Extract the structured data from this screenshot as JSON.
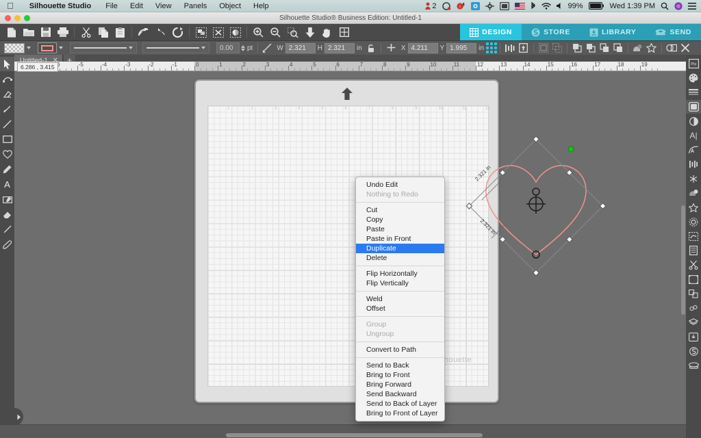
{
  "menubar": {
    "apple_icon": "apple-icon",
    "app_name": "Silhouette Studio",
    "items": [
      "File",
      "Edit",
      "View",
      "Panels",
      "Object",
      "Help"
    ],
    "status": {
      "user_count": "2",
      "battery_pct": "99%",
      "clock": "Wed 1:39 PM",
      "icons": [
        "user-icon",
        "dropbox-icon",
        "alert-icon",
        "photos-icon",
        "gear-icon",
        "display-icon",
        "flag-icon",
        "bluetooth-icon",
        "wifi-icon",
        "volume-icon",
        "battery-icon",
        "search-icon",
        "siri-icon",
        "notification-center-icon"
      ]
    }
  },
  "window": {
    "title": "Silhouette Studio® Business Edition: Untitled-1",
    "traffic_lights": [
      "close-button",
      "minimize-button",
      "zoom-button"
    ]
  },
  "toolbar_main": {
    "groups": [
      [
        "new-document-icon",
        "open-document-icon",
        "save-document-icon",
        "print-icon"
      ],
      [
        "cut-icon",
        "copy-icon",
        "paste-icon"
      ],
      [
        "undo-icon",
        "redo-icon",
        "refresh-icon"
      ],
      [
        "select-all-icon",
        "deselect-all-icon",
        "select-by-color-icon"
      ],
      [
        "zoom-in-icon",
        "zoom-out-icon",
        "zoom-selection-icon",
        "fit-to-page-icon",
        "pan-hand-icon",
        "fit-window-icon"
      ]
    ]
  },
  "mode_tabs": [
    {
      "label": "DESIGN",
      "icon": "grid-icon",
      "active": true
    },
    {
      "label": "STORE",
      "icon": "store-icon",
      "active": false
    },
    {
      "label": "LIBRARY",
      "icon": "library-icon",
      "active": false
    },
    {
      "label": "SEND",
      "icon": "send-icon",
      "active": false
    }
  ],
  "toolbar_props": {
    "fill_swatch": "transparent",
    "line_swatch_color": "#f0938c",
    "line_style_label": "solid-line",
    "line_weight_value": "0.00",
    "line_weight_unit": "pt",
    "width_label": "W",
    "width_value": "2.321",
    "height_label": "H",
    "height_value": "2.321",
    "size_unit": "in",
    "lock_aspect_icon": "unlocked-padlock-icon",
    "x_label": "X",
    "x_value": "4.211",
    "y_label": "Y",
    "y_value": "1.995",
    "position_unit": "in",
    "anchor_icon": "anchor-grid-icon",
    "right_icons": [
      "align-icon",
      "center-on-page-icon",
      "group-icon",
      "ungroup-icon",
      "bring-front-icon",
      "bring-forward-icon",
      "send-backward-icon",
      "send-back-icon",
      "shadow-icon",
      "effects-icon",
      "weld-icon",
      "close-icon"
    ]
  },
  "doc_tabs": {
    "tabs": [
      {
        "label": "Untitled-1",
        "close_icon": "close-tab-icon"
      }
    ],
    "new_tab_label": "+"
  },
  "rulers": {
    "cursor_coords": "6.286 , 3.415",
    "h_ticks": [
      "-6",
      "-5",
      "-4",
      "-3",
      "-2",
      "-1",
      "0",
      "1",
      "2",
      "3",
      "4",
      "5",
      "6",
      "7",
      "8",
      "9",
      "10",
      "11",
      "12",
      "13",
      "14",
      "15",
      "16",
      "17",
      "18",
      "19"
    ]
  },
  "left_tools": [
    {
      "icon": "select-arrow-icon",
      "selected": true
    },
    {
      "icon": "edit-points-icon",
      "selected": false
    },
    {
      "icon": "eraser-tool-icon",
      "selected": false
    },
    {
      "icon": "knife-tool-icon",
      "selected": false
    },
    {
      "icon": "line-tool-icon",
      "selected": false
    },
    {
      "icon": "rectangle-tool-icon",
      "selected": false
    },
    {
      "icon": "heart-shape-icon",
      "selected": false
    },
    {
      "icon": "pencil-tool-icon",
      "selected": false
    },
    {
      "icon": "text-tool-icon",
      "selected": false
    },
    {
      "icon": "note-tool-icon",
      "selected": false
    },
    {
      "icon": "eraser-icon",
      "selected": false
    },
    {
      "icon": "knife-icon",
      "selected": false
    },
    {
      "icon": "eyedropper-icon",
      "selected": false
    }
  ],
  "right_panels": [
    {
      "icon": "pixscan-icon",
      "selected": false
    },
    {
      "icon": "color-palette-icon",
      "selected": false
    },
    {
      "icon": "line-style-icon",
      "selected": false
    },
    {
      "icon": "fill-pattern-icon",
      "selected": true
    },
    {
      "icon": "contrast-icon",
      "selected": false
    },
    {
      "icon": "text-style-icon",
      "selected": false
    },
    {
      "icon": "curve-text-icon",
      "selected": false
    },
    {
      "icon": "align-panel-icon",
      "selected": false
    },
    {
      "icon": "sketch-icon",
      "selected": false
    },
    {
      "icon": "shadow-panel-icon",
      "selected": false
    },
    {
      "icon": "star-panel-icon",
      "selected": false
    },
    {
      "icon": "offset-panel-icon",
      "selected": false
    },
    {
      "icon": "trace-panel-icon",
      "selected": false
    },
    {
      "icon": "page-setup-icon",
      "selected": false
    },
    {
      "icon": "cut-settings-icon",
      "selected": false
    },
    {
      "icon": "transform-icon",
      "selected": false
    },
    {
      "icon": "replicate-icon",
      "selected": false
    },
    {
      "icon": "nesting-icon",
      "selected": false
    },
    {
      "icon": "layers-icon",
      "selected": false
    },
    {
      "icon": "library-panel-icon",
      "selected": false
    },
    {
      "icon": "store-panel-icon",
      "selected": false
    },
    {
      "icon": "send-panel-icon",
      "selected": false
    }
  ],
  "canvas": {
    "mat_watermark": "silhouette",
    "mat_arrow_icon": "mat-feed-arrow-icon",
    "shape": {
      "name": "heart-shape",
      "stroke_color": "#f0938c",
      "fill": "none",
      "rotation_deg": 45,
      "dim_label_1": "2.321 in",
      "dim_label_2": "2.321 in",
      "rotate_handle_icon": "rotate-handle-icon",
      "center_mark_icon": "registration-center-icon"
    },
    "mat_col_numbers": [
      "1",
      "2",
      "3",
      "4",
      "5",
      "6",
      "7",
      "8",
      "9",
      "10",
      "11",
      "12"
    ]
  },
  "context_menu": {
    "sections": [
      [
        {
          "label": "Undo Edit",
          "enabled": true,
          "selected": false
        },
        {
          "label": "Nothing to Redo",
          "enabled": false,
          "selected": false
        }
      ],
      [
        {
          "label": "Cut",
          "enabled": true,
          "selected": false
        },
        {
          "label": "Copy",
          "enabled": true,
          "selected": false
        },
        {
          "label": "Paste",
          "enabled": true,
          "selected": false
        },
        {
          "label": "Paste in Front",
          "enabled": true,
          "selected": false
        },
        {
          "label": "Duplicate",
          "enabled": true,
          "selected": true
        },
        {
          "label": "Delete",
          "enabled": true,
          "selected": false
        }
      ],
      [
        {
          "label": "Flip Horizontally",
          "enabled": true,
          "selected": false
        },
        {
          "label": "Flip Vertically",
          "enabled": true,
          "selected": false
        }
      ],
      [
        {
          "label": "Weld",
          "enabled": true,
          "selected": false
        },
        {
          "label": "Offset",
          "enabled": true,
          "selected": false
        }
      ],
      [
        {
          "label": "Group",
          "enabled": false,
          "selected": false
        },
        {
          "label": "Ungroup",
          "enabled": false,
          "selected": false
        }
      ],
      [
        {
          "label": "Convert to Path",
          "enabled": true,
          "selected": false
        }
      ],
      [
        {
          "label": "Send to Back",
          "enabled": true,
          "selected": false
        },
        {
          "label": "Bring to Front",
          "enabled": true,
          "selected": false
        },
        {
          "label": "Bring Forward",
          "enabled": true,
          "selected": false
        },
        {
          "label": "Send Backward",
          "enabled": true,
          "selected": false
        },
        {
          "label": "Send to Back of Layer",
          "enabled": true,
          "selected": false
        },
        {
          "label": "Bring to Front of Layer",
          "enabled": true,
          "selected": false
        }
      ]
    ]
  },
  "bottom_bar": {
    "library_icon": "library-download-icon",
    "expand_icon": "expand-arrow-icon",
    "settings_icon": "gear-icon",
    "help_icon": "help-icon"
  },
  "colors": {
    "accent_cyan": "#29c4dd",
    "tab_inactive": "#2a9fb5",
    "menu_highlight": "#2a7bf0",
    "shape_stroke": "#f0938c",
    "chrome_dark": "#4a4a4a",
    "canvas_bg": "#6e6e6e"
  }
}
